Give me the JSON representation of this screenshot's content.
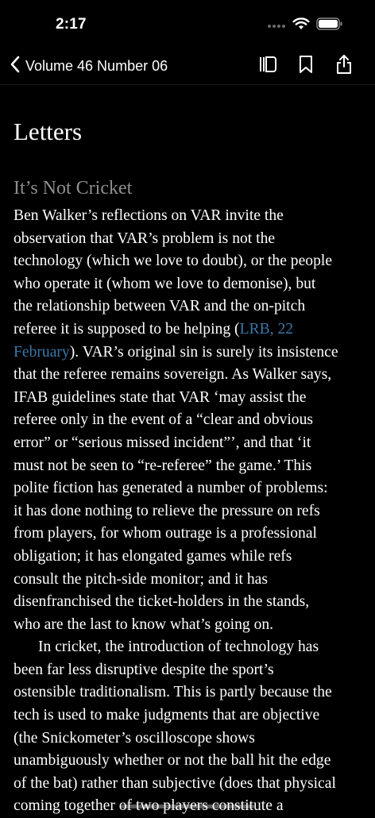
{
  "status_bar": {
    "time": "2:17",
    "icons": [
      "cellular-dots-icon",
      "wifi-icon",
      "battery-icon"
    ]
  },
  "nav": {
    "back_label": "Volume 46 Number 06",
    "icons": [
      "contents-icon",
      "bookmark-icon",
      "share-icon"
    ]
  },
  "section_title": "Letters",
  "article": {
    "title": "It’s Not Cricket",
    "p1": {
      "l1": "Ben Walker’s reflections on VAR invite the",
      "l2": "observation that VAR’s problem is not the",
      "l3": "technology (which we love to doubt), or the people",
      "l4": "who operate it (whom we love to demonise), but",
      "l5": "the relationship between VAR and the on-pitch",
      "l6_pre": "referee it is supposed to be helping (",
      "link_part1": "LRB, 22",
      "link_part2": "February",
      "l7_post": "). VAR’s original sin is surely its insistence",
      "l8": "that the referee remains sovereign. As Walker says,",
      "l9": "IFAB guidelines state that VAR ‘may assist the",
      "l10": "referee only in the event of a “clear and obvious",
      "l11": "error” or “serious missed incident”’, and that ‘it",
      "l12": "must not be seen to “re-referee” the game.’ This",
      "l13": "polite fiction has generated a number of problems:",
      "l14": "it has done nothing to relieve the pressure on refs",
      "l15": "from players, for whom outrage is a professional",
      "l16": "obligation; it has elongated games while refs",
      "l17": "consult the pitch-side monitor; and it has",
      "l18": "disenfranchised the ticket-holders in the stands,",
      "l19": "who are the last to know what’s going on."
    },
    "p2": {
      "l1": "In cricket, the introduction of technology has",
      "l2": "been far less disruptive despite the sport’s",
      "l3": "ostensible traditionalism. This is partly because the",
      "l4": "tech is used to make judgments that are objective",
      "l5": "(the Snickometer’s oscilloscope shows",
      "l6": "unambiguously whether or not the ball hit the edge",
      "l7": "of the bat) rather than subjective (does that physical",
      "l8": "coming together of two players constitute a"
    }
  },
  "colors": {
    "background": "#000000",
    "text": "#ffffff",
    "muted": "#8e8e8e",
    "link": "#3b78a8"
  }
}
